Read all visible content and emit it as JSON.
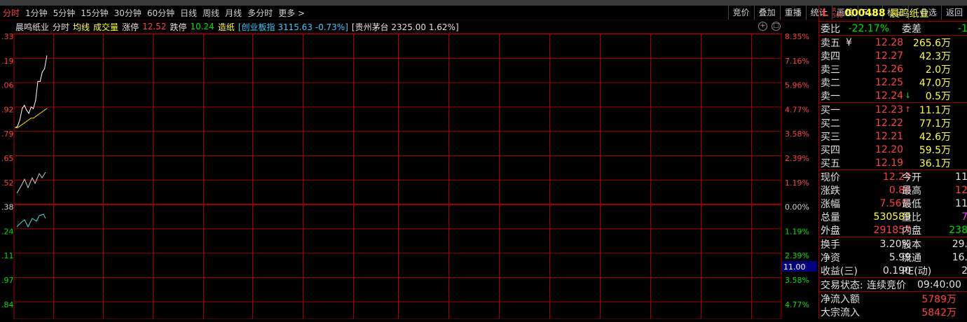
{
  "toolbar": {
    "left": [
      "分时",
      "1分钟",
      "5分钟",
      "15分钟",
      "30分钟",
      "60分钟",
      "日线",
      "周线",
      "月线",
      "多分时",
      "更多 >"
    ],
    "right": [
      "竞价",
      "叠加",
      "重播",
      "统计",
      "画线",
      "F10",
      "标记",
      "+自选",
      "返回"
    ]
  },
  "info_bar": {
    "name": "晨鸣纸业",
    "period": "分时",
    "avg": "均线",
    "vol": "成交量",
    "limit_up_label": "涨停",
    "limit_up_value": "12.52",
    "limit_down_label": "跌停",
    "limit_down_value": "10.24",
    "sector": "造纸",
    "index_text": "[创业板指 3115.63 -0.73%]",
    "overlay_text": "[贵州茅台 2325.00 1.62%]"
  },
  "y_left": [
    ".33",
    ".19",
    ".06",
    ".92",
    ".79",
    ".65",
    ".52",
    ".38",
    ".24",
    ".11",
    ".97",
    ".84"
  ],
  "y_right": [
    "8.35%",
    "7.16%",
    "5.96%",
    "4.77%",
    "3.58%",
    "2.39%",
    "1.19%",
    "0.00%",
    "1.19%",
    "2.39%",
    "3.58%",
    "4.77%"
  ],
  "cursor_label": "11.00",
  "chart_data": {
    "type": "line",
    "series": [
      {
        "values": [
          11.79,
          11.8,
          11.84,
          11.91,
          11.93,
          11.9,
          11.88,
          11.92,
          11.91,
          11.96,
          12.08,
          12.08,
          12.14,
          12.16,
          12.24
        ]
      },
      {
        "values": [
          11.79,
          11.79,
          11.8,
          11.81,
          11.82,
          11.83,
          11.84,
          11.85,
          11.85,
          11.86,
          11.87,
          11.88,
          11.89,
          11.9,
          11.91
        ]
      }
    ],
    "ylim": [
      10.7,
      12.38
    ]
  },
  "right_panel": {
    "header": {
      "l": "L",
      "r_top": "R",
      "r_bottom": "500",
      "code": "000488",
      "name": "晨鸣纸业"
    },
    "ratio": {
      "label": "委比",
      "value": "-22.17%",
      "label2": "委差",
      "value2": "-1"
    },
    "asks": [
      {
        "label": "卖五",
        "extra": "¥",
        "price": "12.28",
        "vol": "265.6万"
      },
      {
        "label": "卖四",
        "extra": "",
        "price": "12.27",
        "vol": "42.3万"
      },
      {
        "label": "卖三",
        "extra": "",
        "price": "12.26",
        "vol": "2.0万"
      },
      {
        "label": "卖二",
        "extra": "",
        "price": "12.25",
        "vol": "47.0万"
      },
      {
        "label": "卖一",
        "extra": "",
        "price": "12.24",
        "arrow": "↓",
        "vol": "0.5万"
      }
    ],
    "bids": [
      {
        "label": "买一",
        "price": "12.23",
        "arrow": "↑",
        "vol": "11.1万"
      },
      {
        "label": "买二",
        "price": "12.22",
        "vol": "77.1万"
      },
      {
        "label": "买三",
        "price": "12.21",
        "vol": "42.6万"
      },
      {
        "label": "买四",
        "price": "12.20",
        "vol": "59.5万"
      },
      {
        "label": "买五",
        "price": "12.19",
        "vol": "36.1万"
      }
    ],
    "stats": [
      {
        "l1": "现价",
        "v1": "12.24",
        "l2": "今开",
        "v2": "11"
      },
      {
        "l1": "涨跌",
        "v1": "0.86",
        "l2": "最高",
        "v2": "12"
      },
      {
        "l1": "涨幅",
        "v1": "7.56%",
        "l2": "最低",
        "v2": "11"
      },
      {
        "l1": "总量",
        "v1": "530589",
        "l2": "量比",
        "v2": "7"
      },
      {
        "l1": "外盘",
        "v1": "291857",
        "l2": "内盘",
        "v2": "238"
      }
    ],
    "stats2": [
      {
        "l1": "换手",
        "v1": "3.20%",
        "l2": "股本",
        "v2": "29."
      },
      {
        "l1": "净资",
        "v1": "5.99",
        "l2": "流通",
        "v2": "16."
      },
      {
        "l1": "收益(三)",
        "v1": "0.190",
        "l2": "PE(动)",
        "v2": "2"
      }
    ],
    "trade_status": {
      "label": "交易状态:",
      "value": "连续竞价",
      "time": "09:40:00"
    },
    "flow": [
      {
        "label": "净流入额",
        "value": "5789万"
      },
      {
        "label": "大宗流入",
        "value": "5842万"
      }
    ]
  }
}
